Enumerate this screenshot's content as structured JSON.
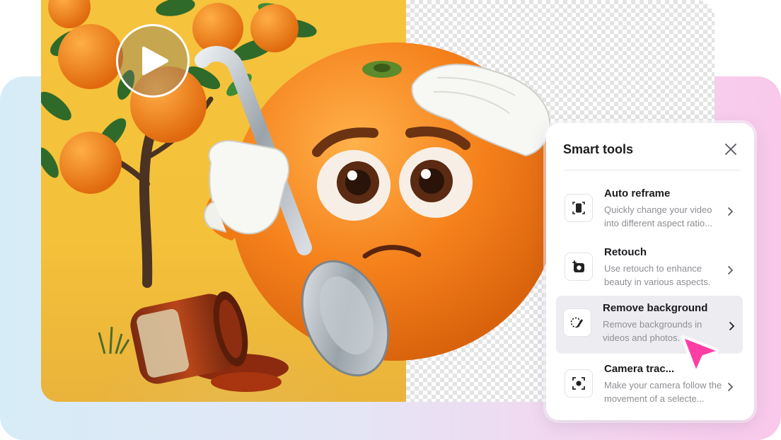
{
  "panel": {
    "title": "Smart tools",
    "close_icon": "close-icon",
    "tools": [
      {
        "title": "Auto reframe",
        "description": "Quickly change your video into different aspect ratio...",
        "icon": "reframe-icon",
        "active": false
      },
      {
        "title": "Retouch",
        "description": "Use retouch to enhance beauty in various aspects.",
        "icon": "retouch-icon",
        "active": false
      },
      {
        "title": "Remove background",
        "description": "Remove backgrounds in videos and photos.",
        "icon": "remove-background-icon",
        "active": true
      },
      {
        "title": "Camera trac...",
        "description": "Make your camera follow the movement of a selecte...",
        "icon": "camera-tracking-icon",
        "active": false
      }
    ]
  },
  "media": {
    "play_icon": "play-icon",
    "preview_subject": "cartoon-orange-with-spoon"
  },
  "colors": {
    "accent_pink": "#ff3ea5",
    "photo_yellow": "#f4c13a",
    "orange": "#f07a12"
  }
}
